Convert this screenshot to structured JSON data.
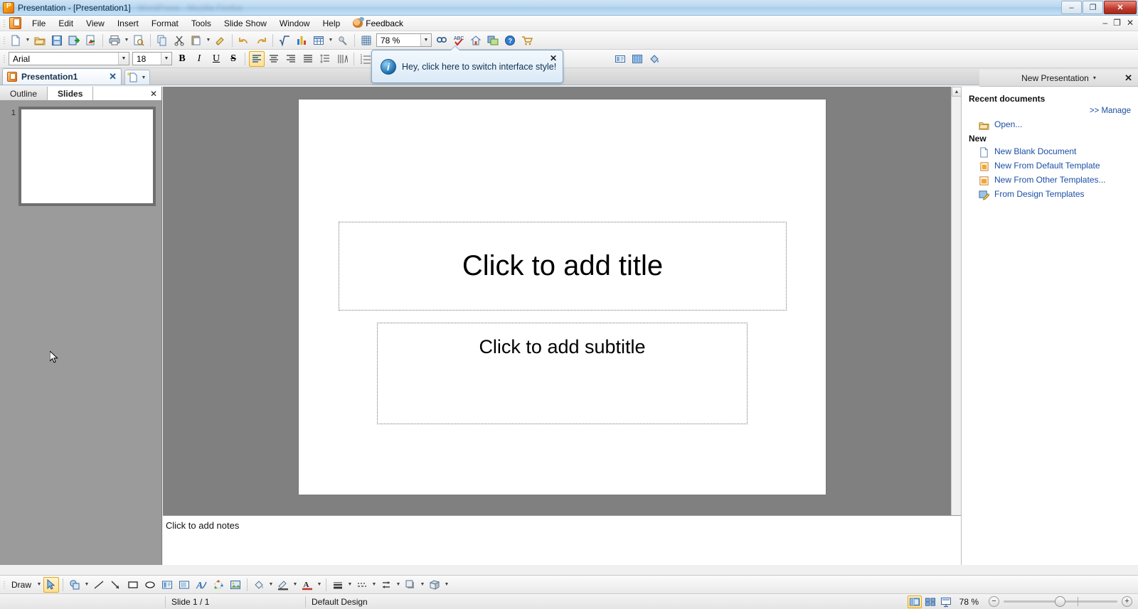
{
  "window": {
    "title": "Presentation - [Presentation1]",
    "blurred_suffix": "WordPress - Mozilla Firefox",
    "app_icon": "presentation-app-icon",
    "controls": {
      "minimize": "–",
      "restore": "❐",
      "close": "✕"
    },
    "mdi_controls": {
      "minimize": "–",
      "restore": "❐",
      "close": "✕"
    }
  },
  "menubar": {
    "items": [
      {
        "label": "File"
      },
      {
        "label": "Edit"
      },
      {
        "label": "View"
      },
      {
        "label": "Insert"
      },
      {
        "label": "Format"
      },
      {
        "label": "Tools"
      },
      {
        "label": "Slide Show"
      },
      {
        "label": "Window"
      },
      {
        "label": "Help"
      }
    ],
    "feedback_label": "Feedback"
  },
  "standard_toolbar": {
    "zoom_value": "78 %",
    "buttons": [
      {
        "name": "new-document-icon",
        "title": "New"
      },
      {
        "name": "open-folder-icon",
        "title": "Open"
      },
      {
        "name": "save-icon",
        "title": "Save"
      },
      {
        "name": "save-as-icon",
        "title": "Save As"
      },
      {
        "name": "export-pdf-icon",
        "title": "Export as PDF"
      },
      {
        "name": "print-icon",
        "title": "Print"
      },
      {
        "name": "print-preview-icon",
        "title": "Print Preview"
      },
      {
        "name": "copy-icon",
        "title": "Copy"
      },
      {
        "name": "cut-icon",
        "title": "Cut"
      },
      {
        "name": "paste-icon",
        "title": "Paste"
      },
      {
        "name": "format-painter-icon",
        "title": "Clone Formatting"
      },
      {
        "name": "undo-icon",
        "title": "Undo"
      },
      {
        "name": "redo-icon",
        "title": "Redo"
      },
      {
        "name": "formula-icon",
        "title": "Insert Formula"
      },
      {
        "name": "chart-icon",
        "title": "Insert Chart"
      },
      {
        "name": "table-icon",
        "title": "Insert Table"
      },
      {
        "name": "hyperlink-icon",
        "title": "Hyperlink"
      },
      {
        "name": "grid-icon",
        "title": "Display Grid"
      },
      {
        "name": "find-replace-icon",
        "title": "Find & Replace"
      },
      {
        "name": "spellcheck-icon",
        "title": "Spelling"
      },
      {
        "name": "home-icon",
        "title": "Home"
      },
      {
        "name": "gallery-icon",
        "title": "Gallery"
      },
      {
        "name": "help-icon",
        "title": "Help"
      },
      {
        "name": "cart-icon",
        "title": "Store"
      }
    ]
  },
  "formatting_toolbar": {
    "font_name": "Arial",
    "font_size": "18",
    "buttons": [
      {
        "name": "bold-button",
        "label": "B"
      },
      {
        "name": "italic-button",
        "label": "I"
      },
      {
        "name": "underline-button",
        "label": "U"
      },
      {
        "name": "strikethrough-button",
        "label": "S"
      },
      {
        "name": "align-left-button",
        "label": "align-left-icon"
      },
      {
        "name": "align-center-button",
        "label": "align-center-icon"
      },
      {
        "name": "align-right-button",
        "label": "align-right-icon"
      },
      {
        "name": "align-justify-button",
        "label": "align-justify-icon"
      },
      {
        "name": "line-spacing-button",
        "label": "line-spacing-icon"
      },
      {
        "name": "text-direction-button",
        "label": "text-direction-icon"
      },
      {
        "name": "numbered-list-button",
        "label": "numbered-list-icon"
      },
      {
        "name": "bulleted-list-button",
        "label": "bulleted-list-icon"
      },
      {
        "name": "insert-textbox-button",
        "label": "textbox-icon"
      },
      {
        "name": "insert-table-button",
        "label": "table-grid-icon"
      },
      {
        "name": "fill-color-button",
        "label": "paint-bucket-icon"
      }
    ]
  },
  "balloon": {
    "message": "Hey, click here to switch interface style!",
    "icon": "info-icon",
    "close": "✕"
  },
  "document_tab": {
    "label": "Presentation1",
    "close": "✕",
    "new_button": "new-document-tab-icon"
  },
  "slide_panel": {
    "tabs": [
      {
        "label": "Outline",
        "active": false
      },
      {
        "label": "Slides",
        "active": true
      }
    ],
    "close": "✕",
    "thumbnails": [
      {
        "number": "1"
      }
    ]
  },
  "slide": {
    "title_placeholder": "Click to add title",
    "subtitle_placeholder": "Click to add subtitle"
  },
  "notes": {
    "placeholder": "Click to add notes"
  },
  "task_pane": {
    "title": "New Presentation",
    "dropdown_arrow": "▾",
    "close": "✕",
    "recent_header": "Recent documents",
    "manage_link": ">> Manage",
    "open_link": "Open...",
    "new_header": "New",
    "links": [
      {
        "label": "New Blank Document",
        "icon": "blank-document-icon"
      },
      {
        "label": "New From Default Template",
        "icon": "default-template-icon"
      },
      {
        "label": "New From Other Templates...",
        "icon": "other-templates-icon"
      },
      {
        "label": "From Design Templates",
        "icon": "design-template-icon"
      }
    ]
  },
  "drawing_toolbar": {
    "draw_label": "Draw",
    "buttons": [
      {
        "name": "select-arrow-tool",
        "icon": "cursor-arrow-icon"
      },
      {
        "name": "autoshapes-menu",
        "icon": "shapes-icon"
      },
      {
        "name": "line-tool",
        "icon": "line-icon"
      },
      {
        "name": "arrow-tool",
        "icon": "arrow-icon"
      },
      {
        "name": "rectangle-tool",
        "icon": "rectangle-icon"
      },
      {
        "name": "ellipse-tool",
        "icon": "ellipse-icon"
      },
      {
        "name": "textbox-tool",
        "icon": "textbox-icon"
      },
      {
        "name": "vertical-text-tool",
        "icon": "vertical-text-icon"
      },
      {
        "name": "fontwork-tool",
        "icon": "fontwork-icon"
      },
      {
        "name": "3d-rotate-tool",
        "icon": "rotate-icon"
      },
      {
        "name": "insert-image-tool",
        "icon": "image-icon"
      },
      {
        "name": "fill-color-tool",
        "icon": "paint-bucket-icon"
      },
      {
        "name": "line-color-tool",
        "icon": "pencil-line-icon"
      },
      {
        "name": "font-color-tool",
        "icon": "font-color-icon"
      },
      {
        "name": "line-style-tool",
        "icon": "line-style-icon"
      },
      {
        "name": "dash-style-tool",
        "icon": "dash-style-icon"
      },
      {
        "name": "arrow-style-tool",
        "icon": "arrow-style-icon"
      },
      {
        "name": "shadow-style-tool",
        "icon": "shadow-icon"
      },
      {
        "name": "3d-style-tool",
        "icon": "cube-icon"
      }
    ]
  },
  "statusbar": {
    "slide_counter": "Slide 1 / 1",
    "design_name": "Default Design",
    "zoom_value": "78 %",
    "view_buttons": [
      {
        "name": "normal-view-button",
        "icon": "normal-view-icon",
        "active": true
      },
      {
        "name": "slide-sorter-button",
        "icon": "slide-sorter-icon",
        "active": false
      },
      {
        "name": "slide-show-button",
        "icon": "slide-show-icon",
        "active": false
      }
    ],
    "zoom_out": "−",
    "zoom_in": "+"
  },
  "colors": {
    "title_bar": "#b9d8f0",
    "accent_link": "#1b4fa5",
    "workspace_gray": "#808080",
    "panel_gray": "#9b9b9b",
    "balloon_border": "#7fa8cc"
  }
}
